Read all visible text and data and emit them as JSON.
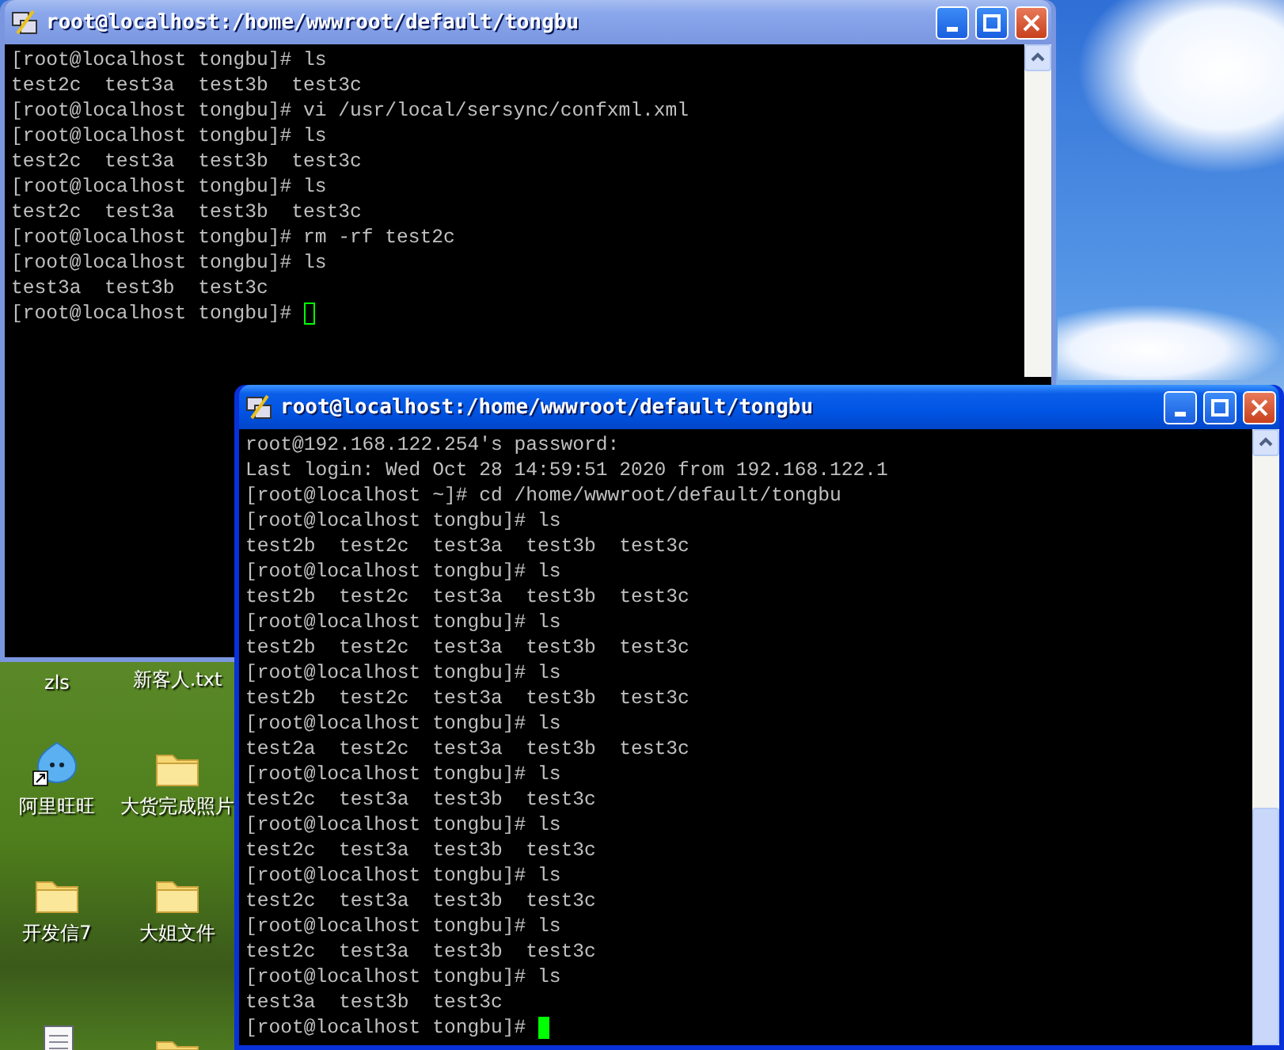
{
  "desktop": {
    "icons": [
      {
        "label": "zls",
        "kind": "hidden"
      },
      {
        "label": "新客人.txt",
        "kind": "hidden"
      },
      {
        "label": "阿里旺旺",
        "kind": "chat"
      },
      {
        "label": "大货完成照片",
        "kind": "folder"
      },
      {
        "label": "开发信7",
        "kind": "folder"
      },
      {
        "label": "大姐文件",
        "kind": "folder"
      },
      {
        "kind": "notepad"
      },
      {
        "kind": "folder"
      }
    ]
  },
  "windows": [
    {
      "title": "root@localhost:/home/wwwroot/default/tongbu",
      "active": false,
      "lines": [
        "[root@localhost tongbu]# ls",
        "test2c  test3a  test3b  test3c",
        "[root@localhost tongbu]# vi /usr/local/sersync/confxml.xml",
        "[root@localhost tongbu]# ls",
        "test2c  test3a  test3b  test3c",
        "[root@localhost tongbu]# ls",
        "test2c  test3a  test3b  test3c",
        "[root@localhost tongbu]# rm -rf test2c",
        "[root@localhost tongbu]# ls",
        "test3a  test3b  test3c",
        "[root@localhost tongbu]# "
      ]
    },
    {
      "title": "root@localhost:/home/wwwroot/default/tongbu",
      "active": true,
      "lines": [
        "root@192.168.122.254's password:",
        "Last login: Wed Oct 28 14:59:51 2020 from 192.168.122.1",
        "[root@localhost ~]# cd /home/wwwroot/default/tongbu",
        "[root@localhost tongbu]# ls",
        "test2b  test2c  test3a  test3b  test3c",
        "[root@localhost tongbu]# ls",
        "test2b  test2c  test3a  test3b  test3c",
        "[root@localhost tongbu]# ls",
        "test2b  test2c  test3a  test3b  test3c",
        "[root@localhost tongbu]# ls",
        "test2b  test2c  test3a  test3b  test3c",
        "[root@localhost tongbu]# ls",
        "test2a  test2c  test3a  test3b  test3c",
        "[root@localhost tongbu]# ls",
        "test2c  test3a  test3b  test3c",
        "[root@localhost tongbu]# ls",
        "test2c  test3a  test3b  test3c",
        "[root@localhost tongbu]# ls",
        "test2c  test3a  test3b  test3c",
        "[root@localhost tongbu]# ls",
        "test2c  test3a  test3b  test3c",
        "[root@localhost tongbu]# ls",
        "test3a  test3b  test3c",
        "[root@localhost tongbu]# "
      ]
    }
  ]
}
